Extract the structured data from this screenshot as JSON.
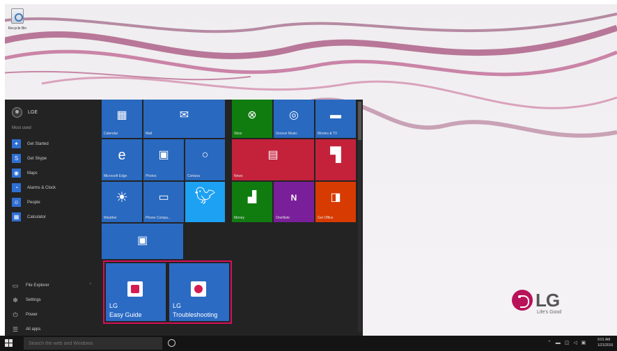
{
  "desktop": {
    "recycle_bin_label": "Recycle Bin",
    "brand": {
      "logo_text": "LG",
      "tagline": "Life's Good",
      "color": "#b8125a"
    }
  },
  "start_menu": {
    "user_name": "LGE",
    "most_used_label": "Most used",
    "most_used": [
      {
        "label": "Get Started",
        "icon": "lightbulb-icon"
      },
      {
        "label": "Get Skype",
        "icon": "skype-icon"
      },
      {
        "label": "Maps",
        "icon": "maps-icon"
      },
      {
        "label": "Alarms & Clock",
        "icon": "alarm-icon"
      },
      {
        "label": "People",
        "icon": "people-icon"
      },
      {
        "label": "Calculator",
        "icon": "calculator-icon"
      }
    ],
    "bottom": [
      {
        "label": "File Explorer",
        "icon": "folder-icon"
      },
      {
        "label": "Settings",
        "icon": "gear-icon"
      },
      {
        "label": "Power",
        "icon": "power-icon"
      },
      {
        "label": "All apps",
        "icon": "all-apps-icon"
      }
    ],
    "tiles": {
      "calendar": "Calendar",
      "mail": "Mail",
      "xbox": "Xbox",
      "groove": "Groove Music",
      "movies": "Movies & TV",
      "edge": "Microsoft Edge",
      "photos": "Photos",
      "cortana": "Cortana",
      "news": "News",
      "weather": "Weather",
      "phone": "Phone Compa...",
      "money": "Money",
      "onenote": "OneNote",
      "office": "Get Office"
    },
    "lg_tiles": [
      {
        "line1": "LG",
        "line2": "Easy Guide"
      },
      {
        "line1": "LG",
        "line2": "Troubleshooting"
      }
    ],
    "highlight_color": "#d6105a"
  },
  "taskbar": {
    "search_placeholder": "Search the web and Windows",
    "time": "9:01 AM",
    "date": "1/21/2016"
  }
}
